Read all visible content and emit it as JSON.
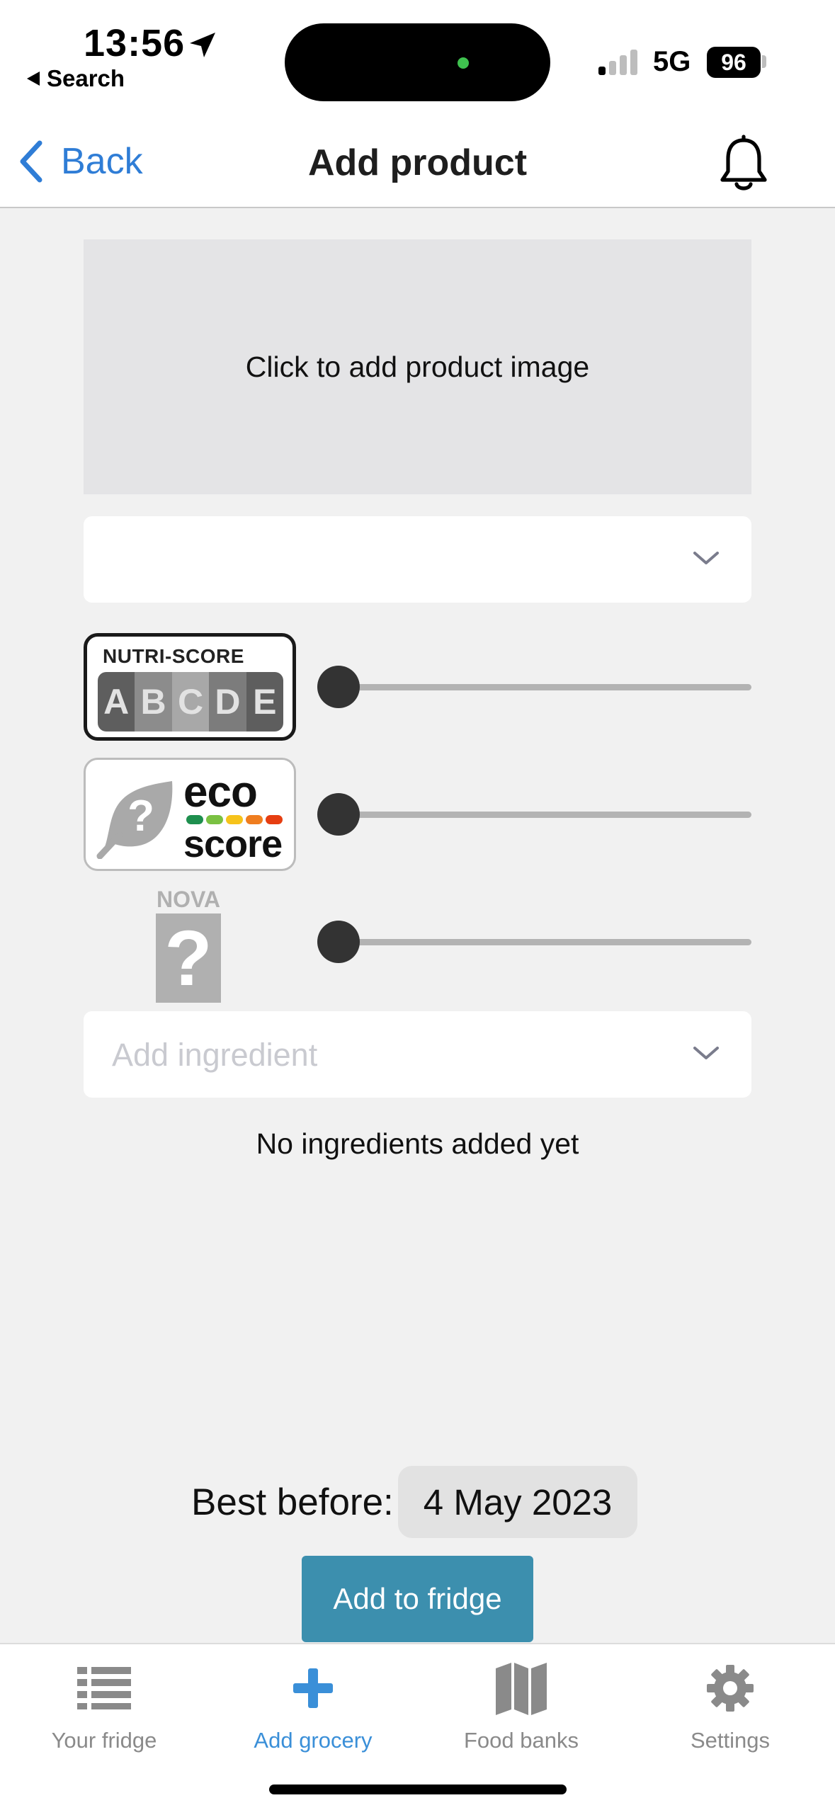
{
  "status_bar": {
    "time": "13:56",
    "back_app": "Search",
    "network": "5G",
    "battery": "96"
  },
  "nav": {
    "back_label": "Back",
    "title": "Add product"
  },
  "form": {
    "image_prompt": "Click to add product image",
    "product_select_value": "",
    "ingredient_placeholder": "Add ingredient",
    "empty_ingredients": "No ingredients added yet",
    "best_before_label": "Best before:",
    "best_before_date": "4 May 2023",
    "submit_label": "Add to fridge"
  },
  "scores": {
    "nutri": {
      "title": "NUTRI-SCORE",
      "grades": [
        "A",
        "B",
        "C",
        "D",
        "E"
      ],
      "slider_value": 0
    },
    "eco": {
      "word1": "eco",
      "word2": "score",
      "slider_value": 0
    },
    "nova": {
      "title": "NOVA",
      "symbol": "?",
      "slider_value": 0
    }
  },
  "tabs": [
    {
      "label": "Your fridge",
      "icon": "list-icon",
      "active": false
    },
    {
      "label": "Add grocery",
      "icon": "plus-icon",
      "active": true
    },
    {
      "label": "Food banks",
      "icon": "map-icon",
      "active": false
    },
    {
      "label": "Settings",
      "icon": "gear-icon",
      "active": false
    }
  ],
  "colors": {
    "accent": "#2f7dd6",
    "button": "#3c8fae",
    "active_tab": "#3a8fd8",
    "inactive_tab": "#8a8a8a"
  }
}
